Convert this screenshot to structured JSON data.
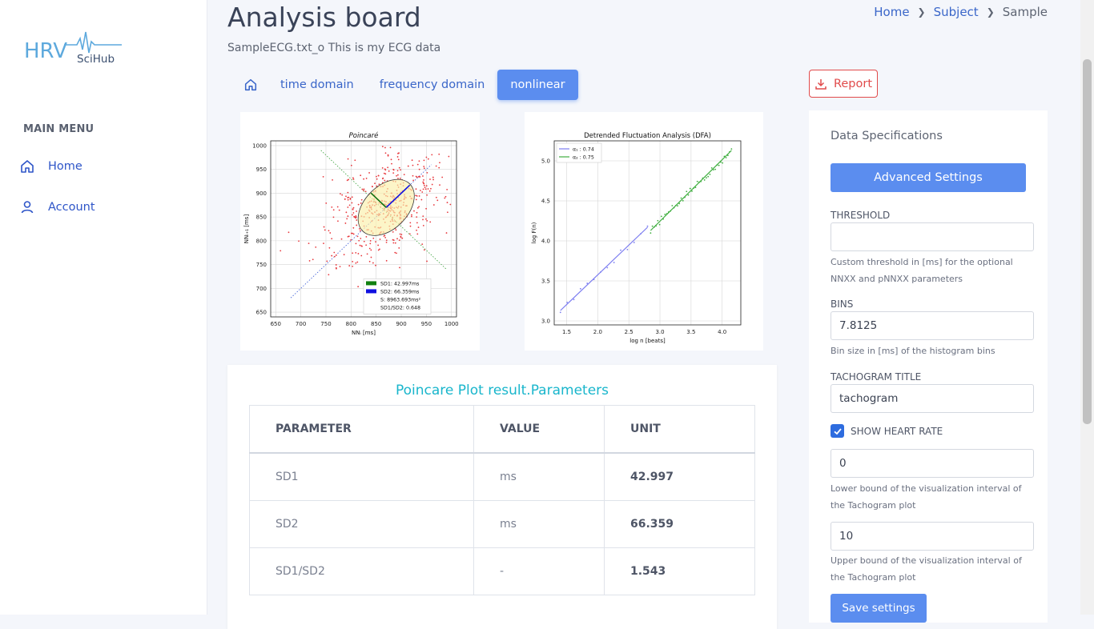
{
  "app": {
    "logo_text_main": "HRV",
    "logo_text_sub": "SciHub"
  },
  "sidebar": {
    "menu_title": "MAIN MENU",
    "items": [
      {
        "label": "Home",
        "icon": "home-icon"
      },
      {
        "label": "Account",
        "icon": "user-icon"
      }
    ]
  },
  "header": {
    "title": "Analysis board",
    "subtitle": "SampleECG.txt_o This is my ECG data",
    "breadcrumb": [
      "Home",
      "Subject",
      "Sample"
    ]
  },
  "tabs": {
    "home_icon": "home-icon",
    "items": [
      "time domain",
      "frequency domain",
      "nonlinear"
    ],
    "active": "nonlinear"
  },
  "report_button": "Report",
  "colors": {
    "accent": "#5b8def",
    "report": "#e14b4b",
    "table_title": "#19b6cc"
  },
  "chart_data": [
    {
      "type": "scatter",
      "title": "Poincaré",
      "xlabel": "NNᵢ [ms]",
      "ylabel": "NNᵢ₊₁ [ms]",
      "xlim": [
        640,
        1010
      ],
      "ylim": [
        640,
        1010
      ],
      "xticks": [
        650,
        700,
        750,
        800,
        850,
        900,
        950,
        1000
      ],
      "yticks": [
        650,
        700,
        750,
        800,
        850,
        900,
        950,
        1000
      ],
      "grid": true,
      "legend": [
        "SD1: 42.997ms",
        "SD2: 66.359ms",
        "S: 8963.693ms²",
        "SD1/SD2: 0.648"
      ],
      "legend_location": "lower right",
      "ellipse": {
        "center": [
          870,
          870
        ],
        "sd1": 42.997,
        "sd2": 66.359
      },
      "points_summary": "~500 red scatter points around (870, 870)"
    },
    {
      "type": "scatter",
      "title": "Detrended Fluctuation Analysis (DFA)",
      "xlabel": "log n [beats]",
      "ylabel": "log F(n)",
      "xlim": [
        1.3,
        4.3
      ],
      "ylim": [
        2.95,
        5.25
      ],
      "xticks": [
        1.5,
        2.0,
        2.5,
        3.0,
        3.5,
        4.0
      ],
      "yticks": [
        3.0,
        3.5,
        4.0,
        4.5,
        5.0
      ],
      "grid": true,
      "legend_location": "upper left",
      "series": [
        {
          "name": "α₁ : 0.74",
          "color": "#7b7cf0",
          "fit": [
            [
              1.4,
              3.13
            ],
            [
              2.8,
              4.17
            ]
          ]
        },
        {
          "name": "α₂ : 0.75",
          "color": "#3fae3f",
          "fit": [
            [
              2.85,
              4.13
            ],
            [
              4.15,
              5.13
            ]
          ]
        }
      ]
    }
  ],
  "table": {
    "title": "Poincare Plot result.Parameters",
    "headers": [
      "PARAMETER",
      "VALUE",
      "UNIT"
    ],
    "rows": [
      [
        "SD1",
        "ms",
        "42.997"
      ],
      [
        "SD2",
        "ms",
        "66.359"
      ],
      [
        "SD1/SD2",
        "-",
        "1.543"
      ]
    ]
  },
  "specs": {
    "title": "Data Specifications",
    "advanced_button": "Advanced Settings",
    "threshold_label": "THRESHOLD",
    "threshold_value": "",
    "threshold_help": "Custom threshold in [ms] for the optional NNXX and pNNXX parameters",
    "bins_label": "BINS",
    "bins_value": "7.8125",
    "bins_help": "Bin size in [ms] of the histogram bins",
    "tachogram_label": "TACHOGRAM TITLE",
    "tachogram_value": "tachogram",
    "show_hr_label": "SHOW HEART RATE",
    "show_hr_checked": true,
    "lower_value": "0",
    "lower_help": "Lower bound of the visualization interval of the Tachogram plot",
    "upper_value": "10",
    "upper_help": "Upper bound of the visualization interval of the Tachogram plot",
    "save_button": "Save settings"
  }
}
